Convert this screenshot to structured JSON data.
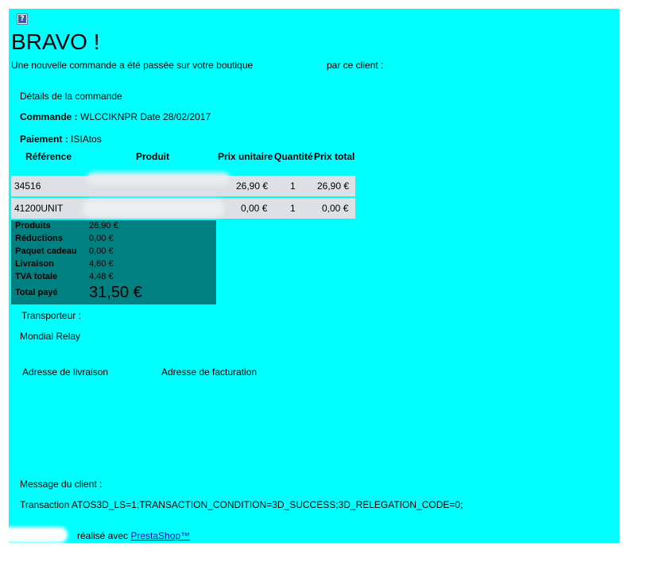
{
  "header": {
    "broken_image_glyph": "?",
    "title": "BRAVO !",
    "intro": "Une nouvelle commande a été passée sur votre boutique",
    "intro_client": "par ce client :"
  },
  "order": {
    "details_heading": "Détails de la commande",
    "command_label": "Commande :",
    "command_value": "WLCCIKNPR Date 28/02/2017",
    "payment_label": "Paiement :",
    "payment_value": "ISIAtos"
  },
  "table": {
    "columns": [
      "Référence",
      "Produit",
      "Prix unitaire",
      "Quantité",
      "Prix total"
    ],
    "rows": [
      {
        "ref": "34516",
        "product": "",
        "unit_price": "26,90 €",
        "qty": "1",
        "total": "26,90 €"
      },
      {
        "ref": "41200UNIT",
        "product": "",
        "unit_price": "0,00 €",
        "qty": "1",
        "total": "0,00 €"
      }
    ]
  },
  "totals": {
    "items": [
      {
        "label": "Produits",
        "value": "26,90 €"
      },
      {
        "label": "Réductions",
        "value": "0,00 €"
      },
      {
        "label": "Paquet cadeau",
        "value": "0,00 €"
      },
      {
        "label": "Livraison",
        "value": "4,60 €"
      },
      {
        "label": "TVA totale",
        "value": "4,48 €"
      }
    ],
    "paid_label": "Total payé",
    "paid_value": "31,50 €",
    "background": "#008080"
  },
  "shipping": {
    "carrier_label": "Transporteur :",
    "carrier_value": "Mondial Relay",
    "delivery_address_label": "Adresse de livraison",
    "billing_address_label": "Adresse de facturation"
  },
  "message": {
    "label": "Message du client :",
    "text": "Transaction ATOS3D_LS=1;TRANSACTION_CONDITION=3D_SUCCESS;3D_RELEGATION_CODE=0;"
  },
  "footer": {
    "made_with": "réalisé avec",
    "link_text": "PrestaShop™"
  },
  "colors": {
    "panel": "#00ffff",
    "row": "#dde1e6",
    "link": "#1a0dab"
  }
}
